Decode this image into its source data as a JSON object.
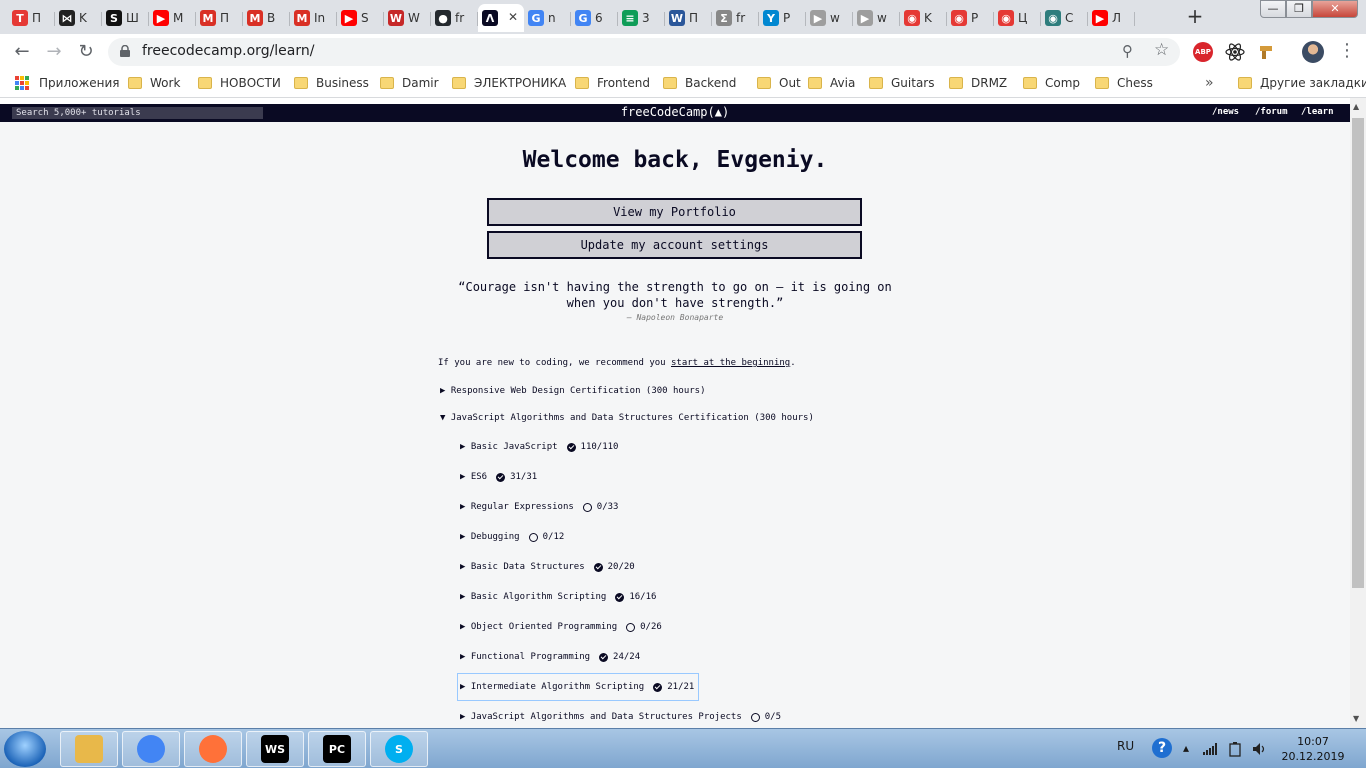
{
  "browser": {
    "tabs": [
      {
        "label": "П",
        "fav": "T",
        "color": "#e53935",
        "textcolor": "#e53935"
      },
      {
        "label": "K",
        "fav": "⋈",
        "color": "#222222"
      },
      {
        "label": "Ш",
        "fav": "S",
        "color": "#111111"
      },
      {
        "label": "M",
        "fav": "▶",
        "color": "#ff0000"
      },
      {
        "label": "П",
        "fav": "M",
        "color": "#d93025"
      },
      {
        "label": "B",
        "fav": "M",
        "color": "#d93025"
      },
      {
        "label": "In",
        "fav": "M",
        "color": "#d93025"
      },
      {
        "label": "S",
        "fav": "▶",
        "color": "#ff0000"
      },
      {
        "label": "W",
        "fav": "W",
        "color": "#c62828"
      },
      {
        "label": "fr",
        "fav": "●",
        "color": "#24292e"
      },
      {
        "label": "",
        "fav": "Λ",
        "color": "#0a0a23",
        "active": true
      },
      {
        "label": "n",
        "fav": "G",
        "color": "#4285f4"
      },
      {
        "label": "6",
        "fav": "G",
        "color": "#4285f4"
      },
      {
        "label": "3",
        "fav": "≡",
        "color": "#0f9d58"
      },
      {
        "label": "П",
        "fav": "W",
        "color": "#2b579a"
      },
      {
        "label": "fr",
        "fav": "Σ",
        "color": "#888888"
      },
      {
        "label": "P",
        "fav": "Y",
        "color": "#0288d1"
      },
      {
        "label": "w",
        "fav": "▶",
        "color": "#9e9e9e"
      },
      {
        "label": "w",
        "fav": "▶",
        "color": "#9e9e9e"
      },
      {
        "label": "K",
        "fav": "◉",
        "color": "#e53935"
      },
      {
        "label": "P",
        "fav": "◉",
        "color": "#e53935"
      },
      {
        "label": "Ц",
        "fav": "◉",
        "color": "#e53935"
      },
      {
        "label": "С",
        "fav": "◉",
        "color": "#2e7d7d"
      },
      {
        "label": "Л",
        "fav": "▶",
        "color": "#ff0000"
      }
    ],
    "tab_close": "✕",
    "new_tab": "+",
    "win_min": "—",
    "win_max": "❐",
    "win_close": "✕",
    "back": "←",
    "forward": "→",
    "reload": "↻",
    "url": "freecodecamp.org/learn/",
    "zoom_icon": "⚲",
    "star_icon": "☆",
    "menu_icon": "⋮",
    "extensions": {
      "abp": "ABP"
    }
  },
  "bookmarks": {
    "apps_label": "Приложения",
    "items": [
      "Work",
      "НОВОСТИ",
      "Business",
      "Damir",
      "ЭЛЕКТРОНИКА",
      "Frontend",
      "Backend",
      "Out",
      "Avia",
      "Guitars",
      "DRMZ",
      "Comp",
      "Chess"
    ],
    "more": "»",
    "other": "Другие закладки"
  },
  "fcc": {
    "search_placeholder": "Search 5,000+ tutorials",
    "logo": "freeCodeCamp(▲)",
    "links": [
      "/news",
      "/forum",
      "/learn"
    ],
    "welcome": "Welcome back, Evgeniy.",
    "portfolio_btn": "View my Portfolio",
    "settings_btn": "Update my account settings",
    "quote_line1": "“Courage isn't having the strength to go on – it is going on",
    "quote_line2": "when you don't have strength.”",
    "quote_author": "– Napoleon Bonaparte",
    "intro_text": "If you are new to coding, we recommend you ",
    "intro_link": "start at the beginning",
    "intro_end": ".",
    "cert1": "▶ Responsive Web Design Certification (300 hours)",
    "cert2": "▼ JavaScript Algorithms and Data Structures Certification (300 hours)",
    "superblocks": [
      {
        "title": "▶ Basic JavaScript",
        "progress": "110/110",
        "done": true
      },
      {
        "title": "▶ ES6",
        "progress": "31/31",
        "done": true
      },
      {
        "title": "▶ Regular Expressions",
        "progress": "0/33",
        "done": false
      },
      {
        "title": "▶ Debugging",
        "progress": "0/12",
        "done": false
      },
      {
        "title": "▶ Basic Data Structures",
        "progress": "20/20",
        "done": true
      },
      {
        "title": "▶ Basic Algorithm Scripting",
        "progress": "16/16",
        "done": true
      },
      {
        "title": "▶ Object Oriented Programming",
        "progress": "0/26",
        "done": false
      },
      {
        "title": "▶ Functional Programming",
        "progress": "24/24",
        "done": true
      },
      {
        "title": "▶ Intermediate Algorithm Scripting",
        "progress": "21/21",
        "done": true
      },
      {
        "title": "▶ JavaScript Algorithms and Data Structures Projects",
        "progress": "0/5",
        "done": false
      }
    ]
  },
  "taskbar": {
    "lang": "RU",
    "help": "?",
    "time": "10:07",
    "date": "20.12.2019",
    "apps": [
      {
        "name": "explorer",
        "label": "",
        "color": "#e8b84a"
      },
      {
        "name": "chrome",
        "label": "",
        "color": "#4285f4"
      },
      {
        "name": "firefox",
        "label": "",
        "color": "#ff7139"
      },
      {
        "name": "webstorm",
        "label": "WS",
        "color": "#000000"
      },
      {
        "name": "pycharm",
        "label": "PC",
        "color": "#000000"
      },
      {
        "name": "skype",
        "label": "S",
        "color": "#00aff0"
      }
    ]
  }
}
